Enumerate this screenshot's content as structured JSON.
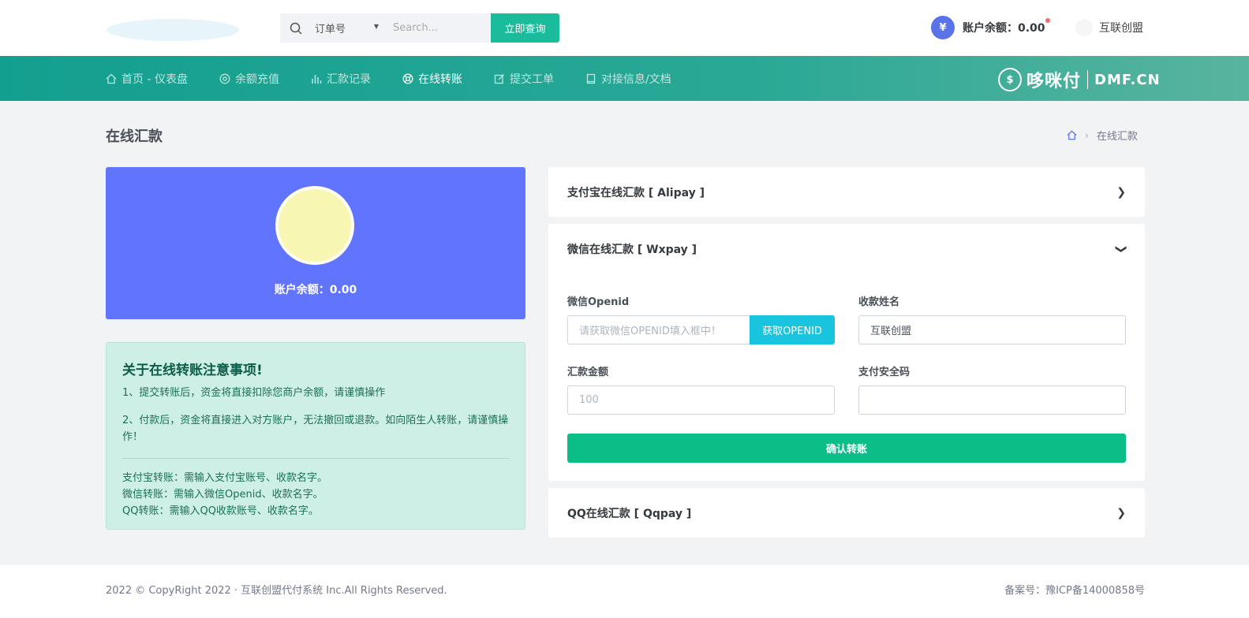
{
  "search": {
    "type_selected": "订单号",
    "placeholder": "Search...",
    "button_label": "立即查询"
  },
  "header": {
    "balance_label": "账户余额：0.00",
    "yen_symbol": "¥",
    "username": "互联创盟"
  },
  "nav": {
    "items": [
      {
        "label": "首页 - 仪表盘",
        "icon": "home-icon"
      },
      {
        "label": "余额充值",
        "icon": "recharge-icon"
      },
      {
        "label": "汇款记录",
        "icon": "bar-chart-icon"
      },
      {
        "label": "在线转账",
        "icon": "lifebuoy-icon",
        "active": true
      },
      {
        "label": "提交工单",
        "icon": "edit-icon"
      },
      {
        "label": "对接信息/文档",
        "icon": "book-icon"
      }
    ],
    "brand_name": "哆咪付",
    "brand_domain": "DMF.CN"
  },
  "page": {
    "title": "在线汇款",
    "breadcrumb_current": "在线汇款"
  },
  "balance_card": {
    "label": "账户余额：0.00"
  },
  "notice": {
    "title": "关于在线转账注意事项!",
    "line1": "1、提交转账后，资金将直接扣除您商户余额，请谨慎操作",
    "line2": "2、付款后，资金将直接进入对方账户，无法撤回或退款。如向陌生人转账，请谨慎操作！",
    "alipay_note": "支付宝转账：需输入支付宝账号、收款名字。",
    "wx_note": "微信转账：需输入微信Openid、收款名字。",
    "qq_note": "QQ转账：需输入QQ收款账号、收款名字。"
  },
  "accordion": {
    "alipay_title": "支付宝在线汇款 [ Alipay ]",
    "wxpay_title": "微信在线汇款 [ Wxpay ]",
    "qqpay_title": "QQ在线汇款 [ Qqpay ]"
  },
  "form": {
    "openid_label": "微信Openid",
    "openid_placeholder": "请获取微信OPENID填入框中！",
    "openid_button": "获取OPENID",
    "name_label": "收款姓名",
    "name_value": "互联创盟",
    "amount_label": "汇款金额",
    "amount_placeholder": "100",
    "code_label": "支付安全码",
    "code_value": "",
    "submit_label": "确认转账"
  },
  "footer": {
    "copyright": "2022 © CopyRight 2022 · 互联创盟代付系统 Inc.All Rights Reserved.",
    "icp": "备案号：豫ICP备14000858号"
  },
  "colors": {
    "accent": "#1abc9c",
    "balance_card": "#6174fe",
    "submit": "#0bbe87",
    "openid_button": "#18c4de"
  }
}
